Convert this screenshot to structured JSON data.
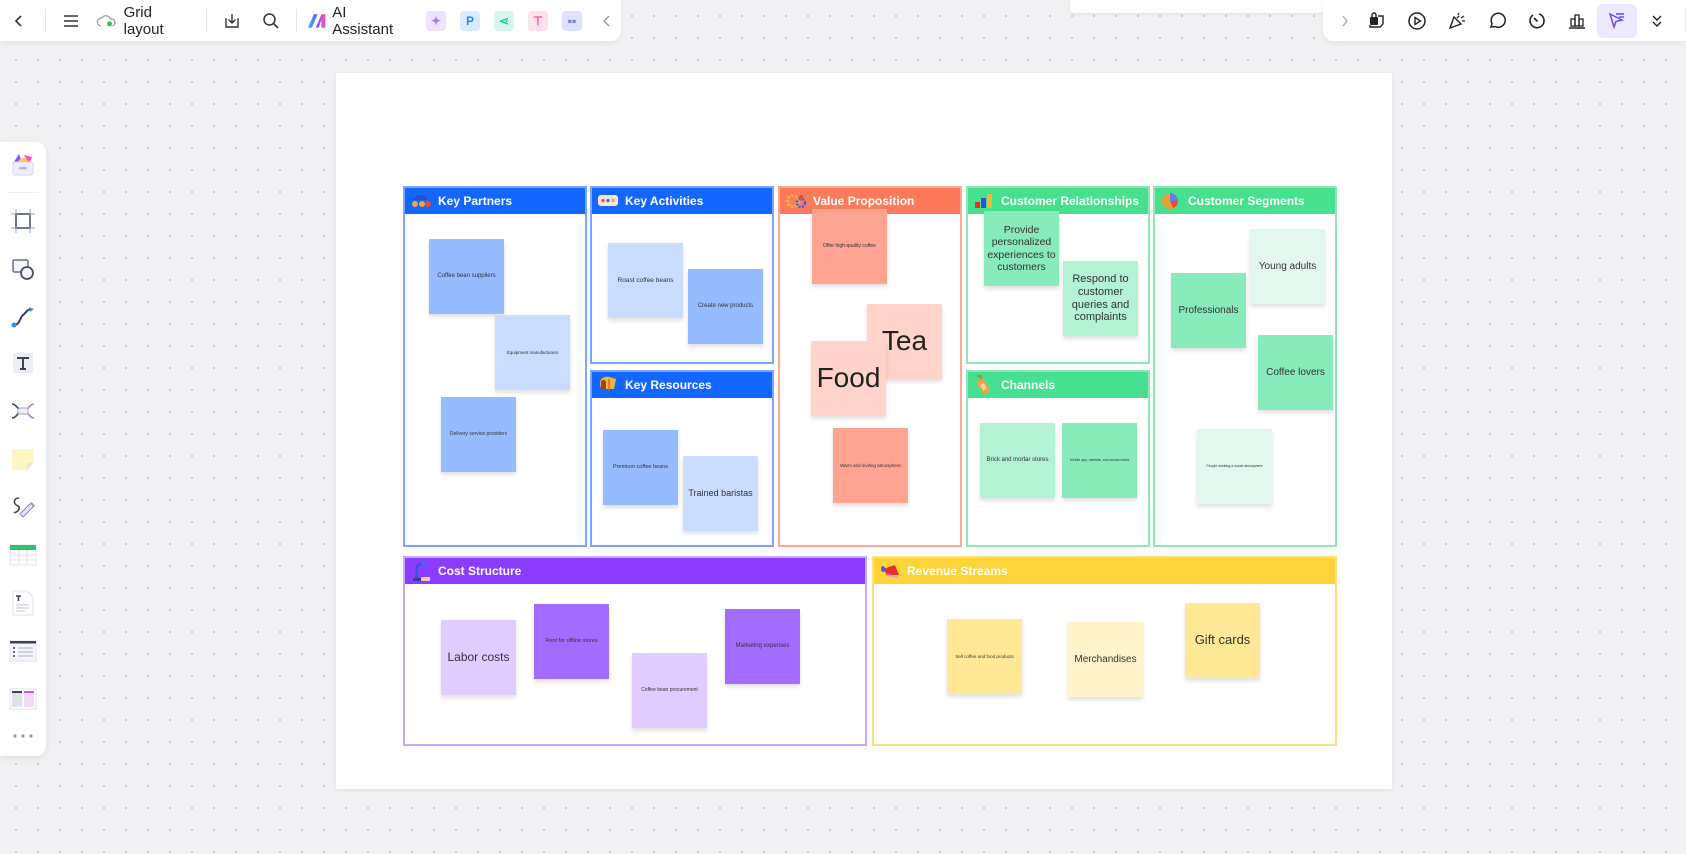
{
  "toolbar": {
    "back_icon": "chevron-left-icon",
    "menu_icon": "hamburger-menu-icon",
    "cloud_icon": "cloud-saved-icon",
    "title": "Grid layout",
    "download_icon": "download-icon",
    "search_icon": "search-icon",
    "ai_label": "AI Assistant",
    "apps": [
      {
        "name": "ai-image-icon",
        "glyph": "✦",
        "bg": "#ede3ff",
        "fg": "#a97af5"
      },
      {
        "name": "ai-ppt-icon",
        "glyph": "P",
        "bg": "#d9ecff",
        "fg": "#1d8af3"
      },
      {
        "name": "ai-mindmap-icon",
        "glyph": "⋖",
        "bg": "#d6f7f0",
        "fg": "#1fc9a6"
      },
      {
        "name": "ai-flowchart-icon",
        "glyph": "⊤",
        "bg": "#ffe1ea",
        "fg": "#ef5a8a"
      },
      {
        "name": "ai-chat-icon",
        "glyph": "▪▪",
        "bg": "#dfe2ff",
        "fg": "#6a72f5"
      }
    ],
    "collapse_icon": "chevron-left-icon"
  },
  "right_toolbar": {
    "expand_icon": "chevron-right-icon",
    "items": [
      {
        "name": "template-icon",
        "active": false
      },
      {
        "name": "present-icon",
        "active": false
      },
      {
        "name": "celebrate-icon",
        "active": false
      },
      {
        "name": "comment-icon",
        "active": false
      },
      {
        "name": "timer-icon",
        "active": false
      },
      {
        "name": "vote-icon",
        "active": false
      },
      {
        "name": "laser-pointer-icon",
        "active": true
      },
      {
        "name": "more-icon",
        "active": false
      }
    ]
  },
  "side_toolbar": {
    "items": [
      "templates-icon",
      "frame-icon",
      "shape-icon",
      "connector-icon",
      "text-icon",
      "mindmap-icon",
      "sticky-note-icon",
      "pen-icon",
      "table-icon",
      "document-icon",
      "list-icon",
      "layout-icon",
      "more-icon"
    ]
  },
  "canvas": {
    "sections": {
      "key_partners": {
        "title": "Key Partners",
        "color": "#1366ff",
        "border": "#7aa6ff",
        "icon": "binoculars-icon",
        "notes": [
          "Coffee bean suppliers",
          "Equipment manufacturers",
          "Delivery service providers"
        ]
      },
      "key_activities": {
        "title": "Key Activities",
        "color": "#1366ff",
        "border": "#7aa6ff",
        "icon": "chat-bubble-icon",
        "notes": [
          "Roast coffee beans",
          "Create new products"
        ]
      },
      "key_resources": {
        "title": "Key Resources",
        "color": "#1366ff",
        "border": "#7aa6ff",
        "icon": "mailbox-icon",
        "notes": [
          "Premium coffee beans",
          "Trained baristas"
        ]
      },
      "value_proposition": {
        "title": "Value Proposition",
        "color": "#ff7a5c",
        "border": "#ffa896",
        "icon": "gears-icon",
        "notes": [
          "Offer high-quality coffee",
          "Tea",
          "Food",
          "Warm and inviting atmosphere"
        ]
      },
      "customer_relationships": {
        "title": "Customer Relationships",
        "color": "#47e08e",
        "border": "#8fe8b6",
        "icon": "bar-chart-icon",
        "notes": [
          "Provide personalized experiences to customers",
          "Respond to customer queries and complaints"
        ]
      },
      "channels": {
        "title": "Channels",
        "color": "#47e08e",
        "border": "#8fe8b6",
        "icon": "phone-icon",
        "notes": [
          "Brick and mortar stores",
          "Mobile app, website, and social media"
        ]
      },
      "customer_segments": {
        "title": "Customer Segments",
        "color": "#47e08e",
        "border": "#8fe8b6",
        "icon": "pie-chart-icon",
        "notes": [
          "Young adults",
          "Professionals",
          "Coffee lovers",
          "People seeking a social atmosphere"
        ]
      },
      "cost_structure": {
        "title": "Cost Structure",
        "color": "#8a3cff",
        "border": "#c9a6ff",
        "icon": "desk-lamp-icon",
        "notes": [
          "Labor costs",
          "Rent for offline stores",
          "Coffee bean procurement",
          "Marketing expenses"
        ]
      },
      "revenue_streams": {
        "title": "Revenue Streams",
        "color": "#ffd43b",
        "border": "#ffe07a",
        "icon": "megaphone-icon",
        "notes": [
          "Sell coffee and food products",
          "Merchandises",
          "Gift cards"
        ]
      }
    },
    "note_colors": {
      "blue_dark": "#97bbff",
      "blue_light": "#cadcff",
      "red_dark": "#ffa392",
      "red_light": "#ffd2ca",
      "green_dark": "#88ebbb",
      "green_mid": "#b3f2d2",
      "green_light": "#e2f8ee",
      "purple_dark": "#a46bff",
      "purple_light": "#e0ccff",
      "yellow_dark": "#ffe996",
      "yellow_light": "#fff4cc"
    }
  }
}
